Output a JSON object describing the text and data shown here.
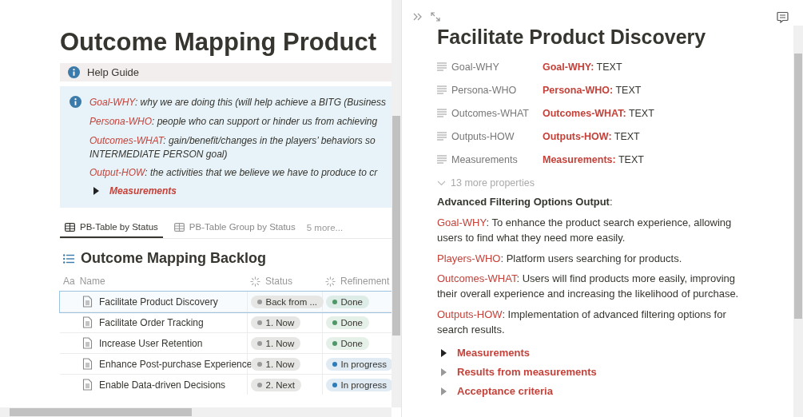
{
  "page": {
    "title": "Outcome Mapping Product",
    "help_guide": {
      "label": "Help Guide"
    },
    "callout": {
      "items": [
        {
          "term": "Goal-WHY",
          "text": ": why we are doing this (will help achieve a BITG (Business"
        },
        {
          "term": "Persona-WHO",
          "text": ": people who can support or hinder us from achieving"
        },
        {
          "term": "Outcomes-WHAT",
          "text": ": gain/benefit/changes in the players’ behaviors so\nINTERMEDIATE PERSON goal)"
        },
        {
          "term": "Output-HOW",
          "text": ": the activities that we believe we have to produce to cr"
        }
      ],
      "toggle": {
        "label": "Measurements",
        "expanded": false
      }
    },
    "views": [
      {
        "label": "PB-Table by Status",
        "selected": true
      },
      {
        "label": "PB-Table Group by Status",
        "selected": false
      }
    ],
    "more_views": "5 more...",
    "database_title": "Outcome Mapping Backlog",
    "table": {
      "columns": [
        {
          "label": "Name",
          "prefix": "Aa"
        },
        {
          "label": "Status"
        },
        {
          "label": "Refinement"
        }
      ],
      "rows": [
        {
          "name": "Facilitate Product Discovery",
          "status": "Back from ...",
          "refinement": {
            "label": "Done",
            "color": "#4f9768"
          },
          "selected": true
        },
        {
          "name": "Facilitate Order Tracking",
          "status": "1. Now",
          "refinement": {
            "label": "Done",
            "color": "#4f9768"
          },
          "selected": false
        },
        {
          "name": "Increase User Retention",
          "status": "1. Now",
          "refinement": {
            "label": "Done",
            "color": "#4f9768"
          },
          "selected": false
        },
        {
          "name": "Enhance Post-purchase Experience",
          "status": "1. Now",
          "refinement": {
            "label": "In progress",
            "color": "#2e7cb8"
          },
          "selected": false
        },
        {
          "name": "Enable Data-driven Decisions",
          "status": "2. Next",
          "refinement": {
            "label": "In progress",
            "color": "#2e7cb8"
          },
          "selected": false
        }
      ]
    }
  },
  "peek": {
    "title": "Facilitate Product Discovery",
    "properties": [
      {
        "name": "Goal-WHY",
        "term": "Goal-WHY:",
        "value": " TEXT"
      },
      {
        "name": "Persona-WHO",
        "term": "Persona-WHO:",
        "value": " TEXT"
      },
      {
        "name": "Outcomes-WHAT",
        "term": "Outcomes-WHAT:",
        "value": " TEXT"
      },
      {
        "name": "Outputs-HOW",
        "term": "Outputs-HOW:",
        "value": " TEXT"
      },
      {
        "name": "Measurements",
        "term": "Measurements:",
        "value": " TEXT"
      }
    ],
    "more_properties": "13 more properties",
    "heading": "**Advanced Filtering Options Output**:",
    "paragraphs": [
      {
        "term": "Goal-WHY",
        "text": ": To enhance the product search experience, allowing users to find what they need more easily."
      },
      {
        "term": "Players-WHO",
        "text": ":  Platform users searching for products."
      },
      {
        "term": "Outcomes-WHAT",
        "text": ": Users will find products more easily, improving their overall experience and increasing the likelihood of purchase."
      },
      {
        "term": "Outputs-HOW",
        "text": ":  Implementation of advanced filtering options for search results."
      }
    ],
    "toggles": [
      {
        "label": "Measurements",
        "expanded": false,
        "dark": true
      },
      {
        "label": "Results from measurements",
        "expanded": false,
        "dark": false
      },
      {
        "label": "Acceptance criteria",
        "expanded": false,
        "dark": false
      }
    ]
  }
}
